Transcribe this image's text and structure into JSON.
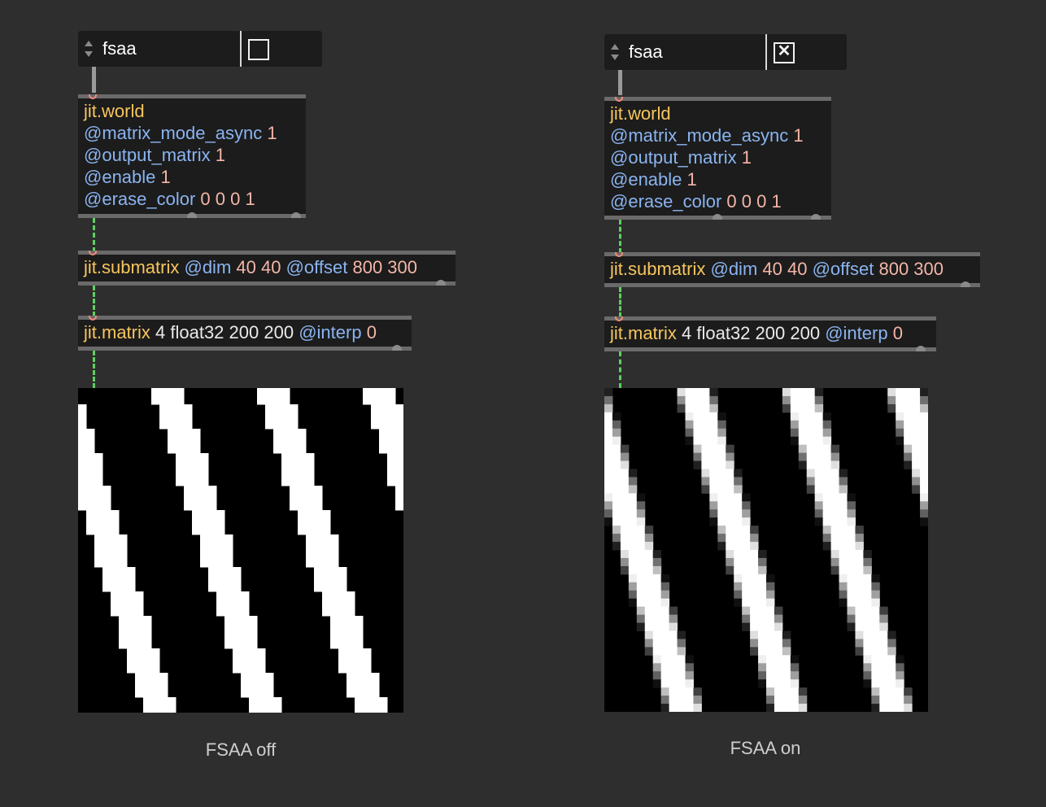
{
  "patches": [
    {
      "param_name": "fsaa",
      "toggle_checked": false,
      "world": {
        "class": "jit.world",
        "lines": [
          {
            "attr": "@matrix_mode_async",
            "value": "1"
          },
          {
            "attr": "@output_matrix",
            "value": "1"
          },
          {
            "attr": "@enable",
            "value": "1"
          },
          {
            "attr": "@erase_color",
            "value": "0 0 0 1"
          }
        ]
      },
      "submatrix": {
        "class": "jit.submatrix",
        "dim_attr": "@dim",
        "dim_value": "40 40",
        "offset_attr": "@offset",
        "offset_value": "800 300"
      },
      "matrix": {
        "class": "jit.matrix",
        "args": "4 float32 200 200",
        "interp_attr": "@interp",
        "interp_value": "0"
      },
      "caption": "FSAA off"
    },
    {
      "param_name": "fsaa",
      "toggle_checked": true,
      "toggle_glyph": "✕",
      "world": {
        "class": "jit.world",
        "lines": [
          {
            "attr": "@matrix_mode_async",
            "value": "1"
          },
          {
            "attr": "@output_matrix",
            "value": "1"
          },
          {
            "attr": "@enable",
            "value": "1"
          },
          {
            "attr": "@erase_color",
            "value": "0 0 0 1"
          }
        ]
      },
      "submatrix": {
        "class": "jit.submatrix",
        "dim_attr": "@dim",
        "dim_value": "40 40",
        "offset_attr": "@offset",
        "offset_value": "800 300"
      },
      "matrix": {
        "class": "jit.matrix",
        "args": "4 float32 200 200",
        "interp_attr": "@interp",
        "interp_value": "0"
      },
      "caption": "FSAA on"
    }
  ],
  "colors": {
    "background": "#2e2e2e",
    "object_body": "#1c1c1c",
    "class_name": "#f7c55d",
    "attribute": "#8ab4f0",
    "number": "#f4b6a8",
    "patch_cord": "#5fd05f"
  }
}
